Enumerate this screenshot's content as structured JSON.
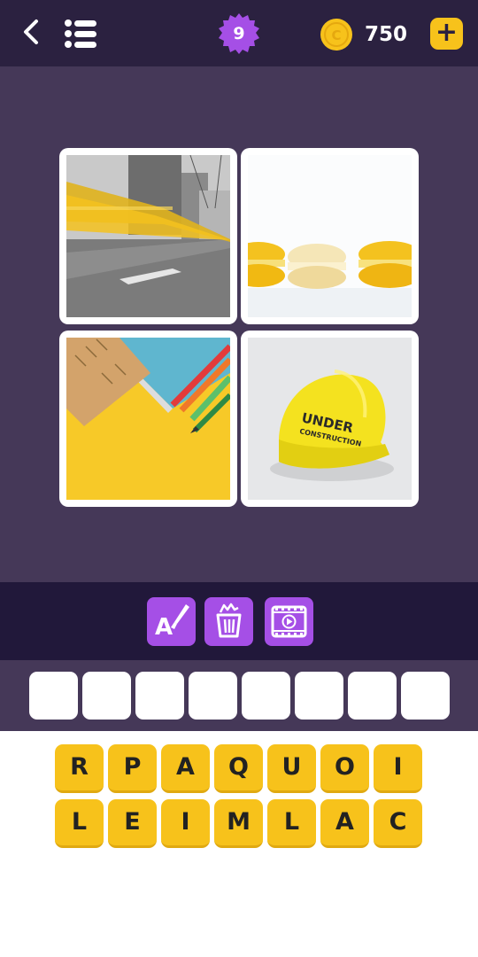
{
  "header": {
    "back_icon": "chevron-left-icon",
    "menu_icon": "list-menu-icon",
    "level": "9",
    "coin_icon": "coin-icon",
    "coin_letter": "C",
    "coins": "750",
    "add_coins_label": "+"
  },
  "puzzle": {
    "images": [
      {
        "name": "yellow-tram-street"
      },
      {
        "name": "yellow-macarons"
      },
      {
        "name": "ruler-notebook-pencils"
      },
      {
        "name": "yellow-hard-hat"
      }
    ],
    "hat_text_line1": "UNDER",
    "hat_text_line2": "CONSTRUCTION"
  },
  "hints": [
    {
      "name": "reveal-letter-hint",
      "icon": "letter-brush-icon",
      "letter": "A"
    },
    {
      "name": "remove-letters-hint",
      "icon": "trash-bin-icon"
    },
    {
      "name": "watch-video-hint",
      "icon": "video-film-icon"
    }
  ],
  "answer": {
    "slots": [
      "",
      "",
      "",
      "",
      "",
      "",
      "",
      ""
    ]
  },
  "letters": {
    "row1": [
      "R",
      "P",
      "A",
      "Q",
      "U",
      "O",
      "I"
    ],
    "row2": [
      "L",
      "E",
      "I",
      "M",
      "L",
      "A",
      "C"
    ]
  },
  "colors": {
    "header_bg": "#2b2140",
    "main_bg": "#453858",
    "hint_bar_bg": "#21183a",
    "hint_button": "#a54fe6",
    "level_badge": "#a54fe6",
    "tile": "#f7c21b"
  }
}
